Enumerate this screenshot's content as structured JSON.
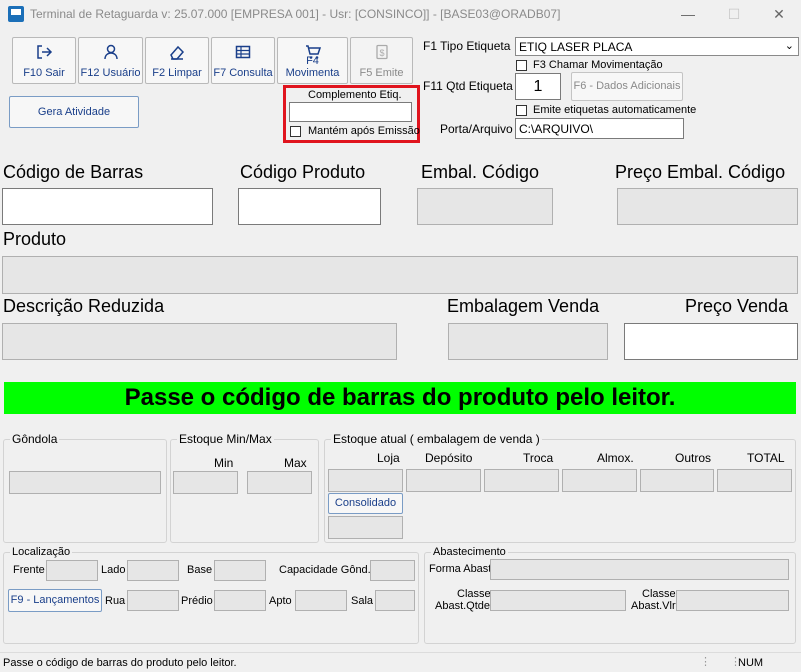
{
  "window": {
    "title": "Terminal de Retaguarda v: 25.07.000 [EMPRESA 001] - Usr: [CONSINCO]] - [BASE03@ORADB07]",
    "minimize": "—",
    "maximize": "☐",
    "close": "✕"
  },
  "toolbar": {
    "buttons": [
      {
        "label": "F10 Sair",
        "icon": "exit-icon"
      },
      {
        "label": "F12 Usuário",
        "icon": "user-icon"
      },
      {
        "label": "F2 Limpar",
        "icon": "eraser-icon"
      },
      {
        "label": "F7 Consulta",
        "icon": "table-icon"
      },
      {
        "label": "F4 Movimenta",
        "icon": "cart-icon"
      },
      {
        "label": "F5 Emite",
        "icon": "dollar-doc-icon"
      }
    ],
    "gera_atividade": "Gera Atividade"
  },
  "complemento": {
    "title": "Complemento Etiq.",
    "value": "",
    "mantem_label": "Mantém após Emissão",
    "mantem_checked": false
  },
  "etiqueta": {
    "tipo_label": "F1 Tipo Etiqueta",
    "tipo_value": "ETIQ LASER PLACA",
    "chamar_mov_label": "F3 Chamar Movimentação",
    "qtd_label": "F11 Qtd Etiqueta",
    "qtd_value": "1",
    "dados_adicionais": "F6 - Dados Adicionais",
    "emite_auto_label": "Emite etiquetas automaticamente",
    "porta_label": "Porta/Arquivo",
    "porta_value": "C:\\ARQUIVO\\"
  },
  "produto": {
    "codigo_barras": "Código de Barras",
    "codigo_produto": "Código Produto",
    "embal_codigo": "Embal. Código",
    "preco_embal_codigo": "Preço Embal. Código",
    "produto": "Produto",
    "descricao_reduzida": "Descrição Reduzida",
    "embalagem_venda": "Embalagem Venda",
    "preco_venda": "Preço Venda"
  },
  "banner": {
    "text": "Passe o código de barras do produto pelo leitor.",
    "color": "#00ff00"
  },
  "estoque": {
    "gondola": "Gôndola",
    "minmax_title": "Estoque Min/Max",
    "min": "Min",
    "max": "Max",
    "atual_title": "Estoque atual ( embalagem de venda )",
    "columns": [
      "Loja",
      "Depósito",
      "Troca",
      "Almox.",
      "Outros",
      "TOTAL"
    ],
    "consolidado": "Consolidado"
  },
  "localizacao": {
    "title": "Localização",
    "frente": "Frente",
    "lado": "Lado",
    "base": "Base",
    "capacidade": "Capacidade Gônd.",
    "lancamentos": "F9 - Lançamentos",
    "rua": "Rua",
    "predio": "Prédio",
    "apto": "Apto",
    "sala": "Sala"
  },
  "abastecimento": {
    "title": "Abastecimento",
    "forma": "Forma Abast",
    "classe_qtde_1": "Classe",
    "classe_qtde_2": "Abast.Qtde",
    "classe_vlr_1": "Classe",
    "classe_vlr_2": "Abast.Vlr"
  },
  "statusbar": {
    "text": "Passe o código de barras do produto pelo leitor.",
    "num": "NUM"
  }
}
